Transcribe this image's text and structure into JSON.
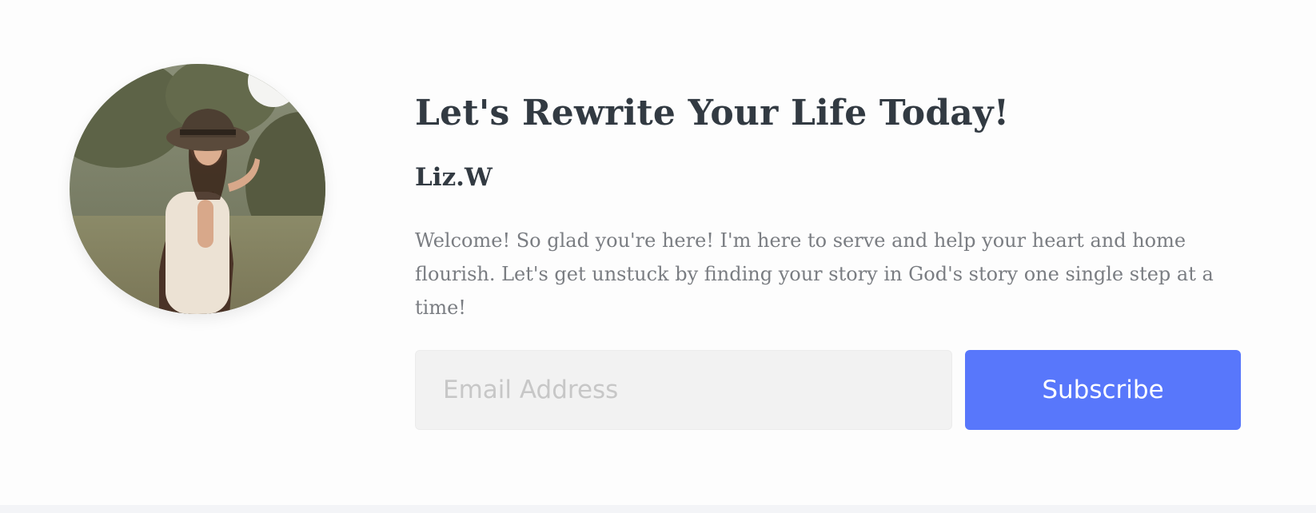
{
  "profile": {
    "avatar_label": "profile-photo",
    "title": "Let's Rewrite Your Life Today!",
    "author": "Liz.W",
    "description": "Welcome! So glad you're here! I'm here to serve and help your heart and home flourish. Let's get unstuck by finding your story in God's story one single step at a time!"
  },
  "signup": {
    "email_placeholder": "Email Address",
    "email_value": "",
    "subscribe_label": "Subscribe"
  },
  "colors": {
    "heading": "#323a42",
    "body_text": "#7a7d82",
    "button": "#5877fb",
    "input_background": "#f2f2f2",
    "page_background": "#fdfdfd"
  }
}
